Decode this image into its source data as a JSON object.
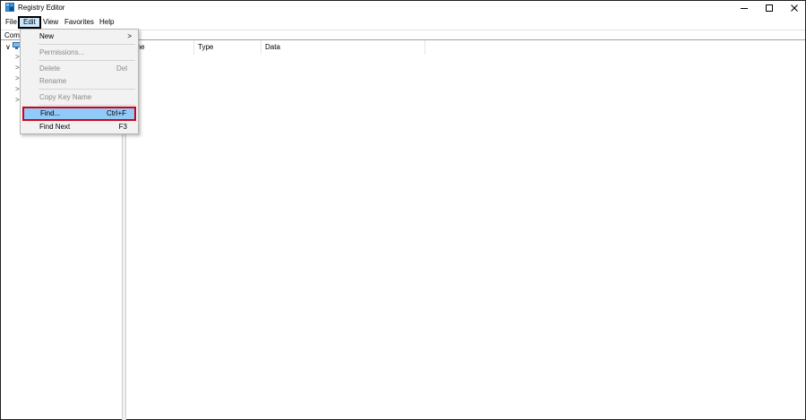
{
  "window": {
    "title": "Registry Editor"
  },
  "menubar": {
    "items": [
      "File",
      "Edit",
      "View",
      "Favorites",
      "Help"
    ]
  },
  "address": {
    "text": "Com"
  },
  "list": {
    "columns": [
      "Name",
      "Type",
      "Data"
    ],
    "name_visible": "ame"
  },
  "edit_menu": {
    "items": [
      {
        "label": "New",
        "shortcut": "",
        "submenu": true,
        "enabled": true
      },
      {
        "label": "Permissions...",
        "shortcut": "",
        "enabled": false
      },
      {
        "label": "Delete",
        "shortcut": "Del",
        "enabled": false
      },
      {
        "label": "Rename",
        "shortcut": "",
        "enabled": false
      },
      {
        "label": "Copy Key Name",
        "shortcut": "",
        "enabled": false
      },
      {
        "label": "Find...",
        "shortcut": "Ctrl+F",
        "enabled": true,
        "highlighted": true
      },
      {
        "label": "Find Next",
        "shortcut": "F3",
        "enabled": true
      }
    ],
    "submenu_arrow": ">"
  },
  "tree": {
    "chevron_collapsed": ">",
    "chevron_expanded": "∨"
  },
  "colors": {
    "highlight_fill": "#91c9f7",
    "highlight_border": "#d0021b",
    "active_menu": "#cce8ff"
  },
  "icons": {
    "app": "registry-icon",
    "minimize": "minimize-icon",
    "maximize": "maximize-icon",
    "close": "close-icon",
    "computer": "computer-icon"
  }
}
